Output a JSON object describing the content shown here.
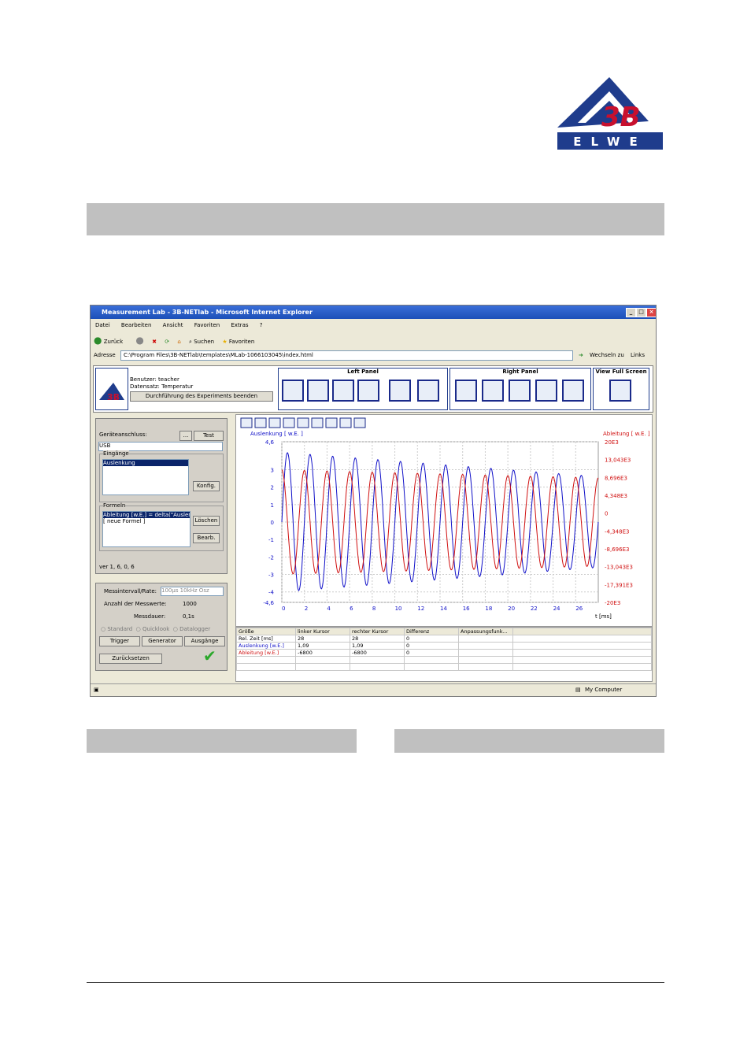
{
  "logo": {
    "text": "3B",
    "subtext": "ELWE",
    "colors": {
      "blue": "#1f3c8c",
      "red": "#c8102e"
    }
  },
  "screenshot": {
    "window_title": "Measurement Lab - 3B-NETlab - Microsoft Internet Explorer",
    "menu": [
      "Datei",
      "Bearbeiten",
      "Ansicht",
      "Favoriten",
      "Extras",
      "?"
    ],
    "toolbar": {
      "back": "Zurück",
      "search": "Suchen",
      "favorites": "Favoriten"
    },
    "address": {
      "label": "Adresse",
      "value": "C:\\Program Files\\3B-NETlab\\templates\\MLab-1066103045\\index.html",
      "go": "Wechseln zu",
      "links": "Links"
    },
    "header": {
      "user": "Benutzer: teacher",
      "dataset": "Datensatz: Temperatur",
      "end_button": "Durchführung des Experiments beenden",
      "left_panel": "Left Panel",
      "right_panel": "Right Panel",
      "full_screen": "View Full Screen"
    },
    "left": {
      "device_label": "Geräteanschluss:",
      "dots": "...",
      "test": "Test",
      "device_value": "USB",
      "inputs_label": "Eingänge",
      "input_item": "Auslenkung",
      "config": "Konfig.",
      "formulas_label": "Formeln",
      "formula_items": [
        "Ableitung [w.E.] = delta(\"Auslenk",
        "[ neue Formel ]"
      ],
      "delete": "Löschen",
      "edit": "Bearb.",
      "version": "ver 1, 6, 0, 6",
      "interval_label": "Messintervall/Rate:",
      "interval_value": "100µs 10kHz Osz",
      "count_label": "Anzahl der Messwerte:",
      "count_value": "1000",
      "duration_label": "Messdauer:",
      "duration_value": "0,1s",
      "modes": [
        "Standard",
        "Quicklook",
        "Datalogger"
      ],
      "trigger": "Trigger",
      "generator": "Generator",
      "outputs": "Ausgänge",
      "reset": "Zurücksetzen"
    },
    "status": {
      "right": "My Computer"
    }
  },
  "chart_data": {
    "type": "line",
    "ylabel": "Auslenkung [ w.E. ]",
    "y2label": "Ableitung [ w.E. ]",
    "xlabel": "t [ms]",
    "xlim": [
      0,
      28
    ],
    "ylim": [
      -4.6,
      4.6
    ],
    "y2lim": [
      -20000,
      20000
    ],
    "x_ticks": [
      "0",
      "2",
      "4",
      "6",
      "8",
      "10",
      "12",
      "14",
      "16",
      "18",
      "20",
      "22",
      "24",
      "26"
    ],
    "y_ticks": [
      "4,6",
      "3",
      "2",
      "1",
      "0",
      "-1",
      "-2",
      "-3",
      "-4",
      "-4,6"
    ],
    "y2_ticks": [
      "20E3",
      "13,043E3",
      "8,696E3",
      "4,348E3",
      "0",
      "-4,348E3",
      "-8,696E3",
      "-13,043E3",
      "-17,391E3",
      "-20E3"
    ],
    "series": [
      {
        "name": "Auslenkung [ w.E. ]",
        "color": "#1010c8",
        "amplitude": [
          4.0,
          2.6
        ],
        "period_ms": 2.0
      },
      {
        "name": "Ableitung [ w.E. ]",
        "color": "#d01010",
        "amplitude": [
          13000,
          11000
        ],
        "period_ms": 2.0
      }
    ],
    "grid": true
  },
  "table": {
    "headers": [
      "Größe",
      "linker Kursor",
      "rechter Kursor",
      "Differenz",
      "Anpassungsfunk..."
    ],
    "rows": [
      {
        "name": "Rel. Zeit [ms]",
        "left": "28",
        "right": "28",
        "diff": "0",
        "color": "#000000"
      },
      {
        "name": "Auslenkung [w.E.]",
        "left": "1,09",
        "right": "1,09",
        "diff": "0",
        "color": "#1010c8"
      },
      {
        "name": "Ableitung [w.E.]",
        "left": "-6800",
        "right": "-6800",
        "diff": "0",
        "color": "#d01010"
      }
    ]
  }
}
